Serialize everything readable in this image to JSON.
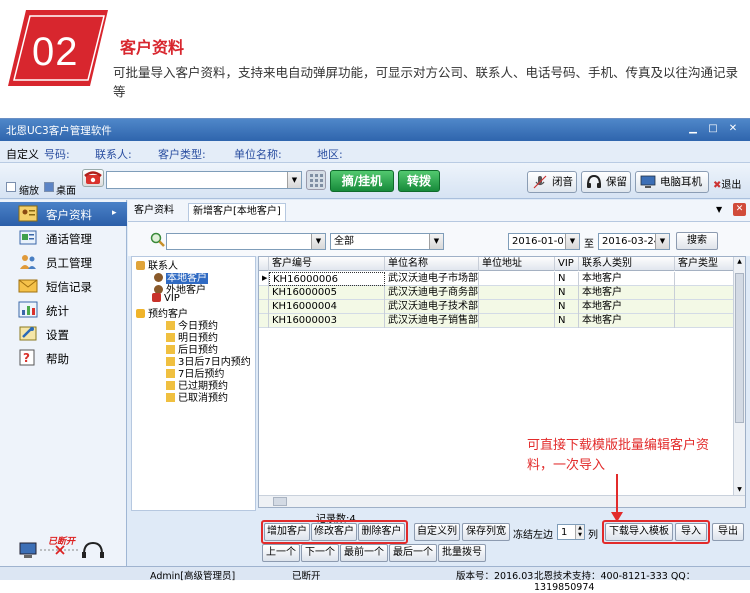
{
  "promo": {
    "number": "02",
    "title": "客户资料",
    "description": "可批量导入客户资料，支持来电自动弹屏功能，可显示对方公司、联系人、电话号码、手机、传真及以往沟通记录等",
    "badge_color": "#d8262e"
  },
  "window": {
    "title": "北恩UC3客户管理软件"
  },
  "fields_bar": {
    "custom_label": "自定义",
    "number_label": "号码:",
    "contact_label": "联系人:",
    "type_label": "客户类型:",
    "company_label": "单位名称:",
    "region_label": "地区:"
  },
  "toolbar": {
    "shrink_label": "缩放",
    "desktop_label": "桌面",
    "pickup_label": "摘/挂机",
    "transfer_label": "转拨",
    "mute_label": "闭音",
    "hold_label": "保留",
    "headset_label": "电脑耳机",
    "exit_label": "退出"
  },
  "nav": {
    "items": [
      {
        "label": "客户资料",
        "icon": "customer-card-icon"
      },
      {
        "label": "通话管理",
        "icon": "call-log-icon"
      },
      {
        "label": "员工管理",
        "icon": "staff-icon"
      },
      {
        "label": "短信记录",
        "icon": "envelope-icon"
      },
      {
        "label": "统计",
        "icon": "chart-icon"
      },
      {
        "label": "设置",
        "icon": "settings-icon"
      },
      {
        "label": "帮助",
        "icon": "help-icon"
      }
    ],
    "status_label": "已断开"
  },
  "tabs": [
    {
      "label": "客户资料"
    },
    {
      "label": "新增客户[本地客户]"
    }
  ],
  "search": {
    "filter_value": "全部",
    "date_from": "2016-01-01",
    "date_sep": "至",
    "date_to": "2016-03-24",
    "search_label": "搜索"
  },
  "tree": [
    {
      "label": "联系人",
      "level": 0
    },
    {
      "label": "本地客户",
      "level": 1,
      "selected": true
    },
    {
      "label": "外地客户",
      "level": 1
    },
    {
      "label": "VIP",
      "level": 0
    },
    {
      "label": "预约客户",
      "level": 0
    },
    {
      "label": "今日预约",
      "level": 1
    },
    {
      "label": "明日预约",
      "level": 1
    },
    {
      "label": "后日预约",
      "level": 1
    },
    {
      "label": "3日后7日内预约",
      "level": 1
    },
    {
      "label": "7日后预约",
      "level": 1
    },
    {
      "label": "已过期预约",
      "level": 1
    },
    {
      "label": "已取消预约",
      "level": 1
    }
  ],
  "grid": {
    "columns": [
      "客户编号",
      "单位名称",
      "单位地址",
      "VIP",
      "联系人类别",
      "客户类型"
    ],
    "rows": [
      [
        "KH16000006",
        "武汉沃迪电子市场部",
        "",
        "N",
        "本地客户",
        ""
      ],
      [
        "KH16000005",
        "武汉沃迪电子商务部",
        "",
        "N",
        "本地客户",
        ""
      ],
      [
        "KH16000004",
        "武汉沃迪电子技术部",
        "",
        "N",
        "本地客户",
        ""
      ],
      [
        "KH16000003",
        "武汉沃迪电子销售部",
        "",
        "N",
        "本地客户",
        ""
      ]
    ]
  },
  "callout": {
    "text": "可直接下载模版批量编辑客户资料，一次导入",
    "color": "#e22b2b"
  },
  "bottom": {
    "record_count": "记录数:4",
    "add_label": "增加客户",
    "edit_label": "修改客户",
    "delete_label": "删除客户",
    "custom_col_label": "自定义列",
    "save_width_label": "保存列宽",
    "freeze_label": "冻结左边",
    "freeze_value": "1",
    "col_unit": "列",
    "download_template_label": "下载导入模板",
    "import_label": "导入",
    "export_label": "导出",
    "prev_label": "上一个",
    "next_label": "下一个",
    "first_label": "最前一个",
    "last_label": "最后一个",
    "batch_dial_label": "批量拨号"
  },
  "status": {
    "user": "Admin[高级管理员]",
    "connection": "已断开",
    "version": "版本号：2016.03",
    "support": "北恩技术支持：400-8121-333 QQ：1319850974"
  }
}
